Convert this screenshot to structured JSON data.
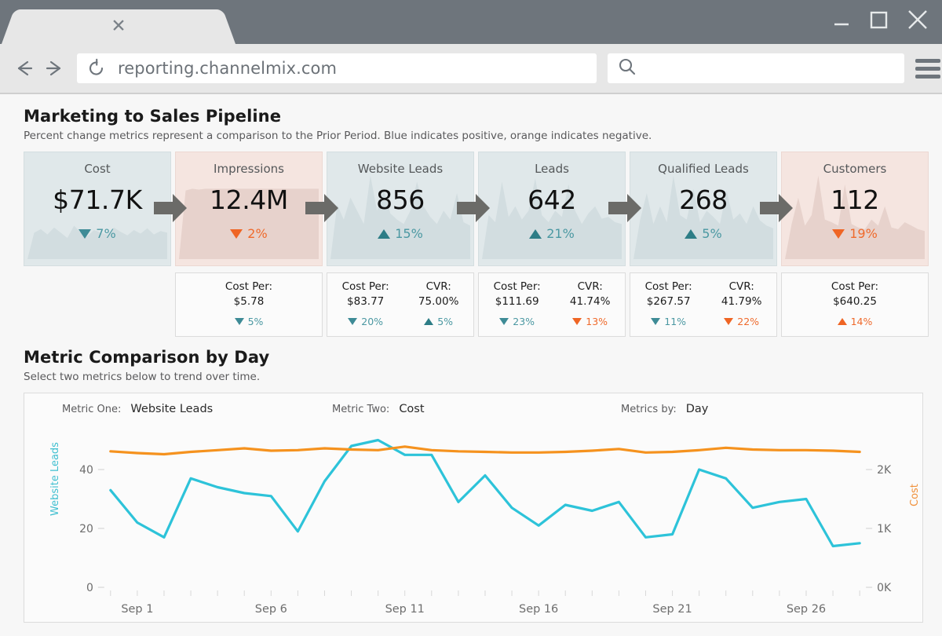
{
  "browser": {
    "tab_close_icon": "close-icon",
    "url": "reporting.channelmix.com",
    "search_placeholder": "",
    "back_icon": "back-arrow-icon",
    "forward_icon": "forward-arrow-icon",
    "reload_icon": "reload-icon",
    "search_icon": "search-icon",
    "menu_icon": "hamburger-menu-icon",
    "minimize_icon": "minimize-icon",
    "maximize_icon": "maximize-icon",
    "close_icon": "close-window-icon"
  },
  "pipeline_section": {
    "title": "Marketing to Sales Pipeline",
    "subtitle": "Percent change metrics represent a comparison to the Prior Period. Blue indicates positive, orange indicates negative.",
    "colors": {
      "positive": "#4b98a2",
      "negative": "#ef6a2c",
      "card_blue": "#e0e8ea",
      "card_red": "#f5e5e0"
    },
    "cards": [
      {
        "title": "Cost",
        "value": "$71.7K",
        "delta": "7%",
        "direction": "down",
        "tone": "positive",
        "bg": "blue"
      },
      {
        "title": "Impressions",
        "value": "12.4M",
        "delta": "2%",
        "direction": "down",
        "tone": "negative",
        "bg": "red"
      },
      {
        "title": "Website Leads",
        "value": "856",
        "delta": "15%",
        "direction": "up",
        "tone": "positive",
        "bg": "blue"
      },
      {
        "title": "Leads",
        "value": "642",
        "delta": "21%",
        "direction": "up",
        "tone": "positive",
        "bg": "blue"
      },
      {
        "title": "Qualified Leads",
        "value": "268",
        "delta": "5%",
        "direction": "up",
        "tone": "positive",
        "bg": "blue"
      },
      {
        "title": "Customers",
        "value": "112",
        "delta": "19%",
        "direction": "down",
        "tone": "negative",
        "bg": "red"
      }
    ],
    "sub_cards": [
      {
        "metrics": [
          {
            "label": "Cost Per:",
            "value": "$5.78",
            "delta": "5%",
            "direction": "down",
            "tone": "positive"
          }
        ]
      },
      {
        "metrics": [
          {
            "label": "Cost Per:",
            "value": "$83.77",
            "delta": "20%",
            "direction": "down",
            "tone": "positive"
          },
          {
            "label": "CVR:",
            "value": "75.00%",
            "delta": "5%",
            "direction": "up",
            "tone": "positive"
          }
        ]
      },
      {
        "metrics": [
          {
            "label": "Cost Per:",
            "value": "$111.69",
            "delta": "23%",
            "direction": "down",
            "tone": "positive"
          },
          {
            "label": "CVR:",
            "value": "41.74%",
            "delta": "13%",
            "direction": "down",
            "tone": "negative"
          }
        ]
      },
      {
        "metrics": [
          {
            "label": "Cost Per:",
            "value": "$267.57",
            "delta": "11%",
            "direction": "down",
            "tone": "positive"
          },
          {
            "label": "CVR:",
            "value": "41.79%",
            "delta": "22%",
            "direction": "down",
            "tone": "negative"
          }
        ]
      },
      {
        "metrics": [
          {
            "label": "Cost Per:",
            "value": "$640.25",
            "delta": "14%",
            "direction": "up",
            "tone": "negative"
          }
        ]
      }
    ]
  },
  "chart_section": {
    "title": "Metric Comparison by Day",
    "subtitle": "Select two metrics below to trend over time.",
    "controls": [
      {
        "label": "Metric One:",
        "value": "Website Leads"
      },
      {
        "label": "Metric Two:",
        "value": "Cost"
      },
      {
        "label": "Metrics by:",
        "value": "Day"
      }
    ]
  },
  "chart_data": {
    "type": "line",
    "title": "Metric Comparison by Day",
    "xlabel": "",
    "grid": false,
    "legend": "none",
    "x": [
      "Aug 31",
      "Sep 1",
      "Sep 2",
      "Sep 3",
      "Sep 4",
      "Sep 5",
      "Sep 6",
      "Sep 7",
      "Sep 8",
      "Sep 9",
      "Sep 10",
      "Sep 11",
      "Sep 12",
      "Sep 13",
      "Sep 14",
      "Sep 15",
      "Sep 16",
      "Sep 17",
      "Sep 18",
      "Sep 19",
      "Sep 20",
      "Sep 21",
      "Sep 22",
      "Sep 23",
      "Sep 24",
      "Sep 25",
      "Sep 26",
      "Sep 27",
      "Sep 28"
    ],
    "xticks": [
      "Sep 1",
      "Sep 6",
      "Sep 11",
      "Sep 16",
      "Sep 21",
      "Sep 26"
    ],
    "axes": [
      {
        "side": "left",
        "label": "Website Leads",
        "color": "#3fbfd0",
        "ticks": [
          "0",
          "20",
          "40"
        ],
        "range": [
          0,
          52
        ]
      },
      {
        "side": "right",
        "label": "Cost",
        "color": "#f0903a",
        "ticks": [
          "0K",
          "1K",
          "2K"
        ],
        "range": [
          0,
          2600
        ]
      }
    ],
    "series": [
      {
        "name": "Website Leads",
        "color": "#2dc3d9",
        "axis": "left",
        "values": [
          33,
          22,
          17,
          37,
          34,
          32,
          31,
          19,
          36,
          48,
          50,
          45,
          45,
          29,
          38,
          27,
          21,
          28,
          26,
          29,
          17,
          18,
          40,
          37,
          27,
          29,
          30,
          14,
          15
        ]
      },
      {
        "name": "Cost",
        "color": "#f5921e",
        "axis": "right",
        "values": [
          2310,
          2280,
          2260,
          2300,
          2330,
          2360,
          2320,
          2330,
          2360,
          2340,
          2330,
          2390,
          2330,
          2310,
          2300,
          2290,
          2290,
          2300,
          2320,
          2350,
          2290,
          2300,
          2330,
          2370,
          2340,
          2330,
          2330,
          2320,
          2300
        ]
      }
    ]
  }
}
